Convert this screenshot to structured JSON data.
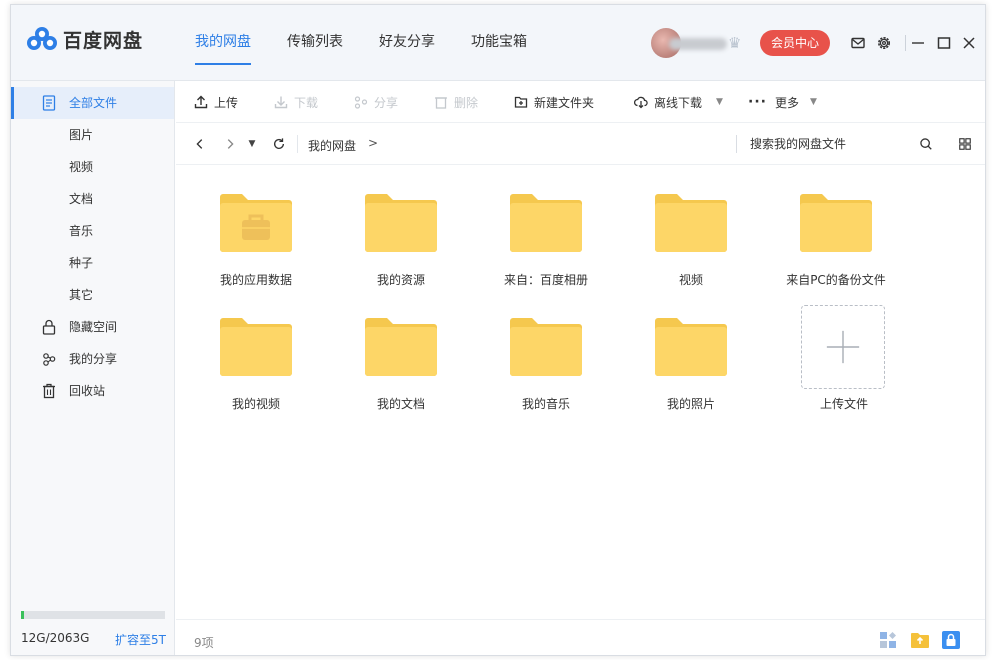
{
  "app": {
    "name": "百度网盘"
  },
  "nav": [
    {
      "label": "我的网盘"
    },
    {
      "label": "传输列表"
    },
    {
      "label": "好友分享"
    },
    {
      "label": "功能宝箱"
    }
  ],
  "header": {
    "vip_label": "会员中心"
  },
  "sidebar": {
    "items": [
      {
        "label": "全部文件",
        "icon": "document-icon"
      },
      {
        "label": "图片"
      },
      {
        "label": "视频"
      },
      {
        "label": "文档"
      },
      {
        "label": "音乐"
      },
      {
        "label": "种子"
      },
      {
        "label": "其它"
      },
      {
        "label": "隐藏空间",
        "icon": "lock-icon"
      },
      {
        "label": "我的分享",
        "icon": "share-icon"
      },
      {
        "label": "回收站",
        "icon": "trash-icon"
      }
    ],
    "storage": {
      "text": "12G/2063G",
      "used_fraction": 0.006,
      "expand_label": "扩容至5T"
    }
  },
  "toolbar": {
    "upload": "上传",
    "download": "下载",
    "share": "分享",
    "delete": "删除",
    "new_folder": "新建文件夹",
    "offline_download": "离线下载",
    "more": "更多"
  },
  "path": {
    "crumb": "我的网盘",
    "arrow": ">",
    "search_placeholder": "搜索我的网盘文件"
  },
  "files": [
    {
      "name": "我的应用数据",
      "type": "app-folder"
    },
    {
      "name": "我的资源",
      "type": "folder"
    },
    {
      "name": "来自：百度相册",
      "type": "folder"
    },
    {
      "name": "视频",
      "type": "folder"
    },
    {
      "name": "来自PC的备份文件",
      "type": "folder"
    },
    {
      "name": "我的视频",
      "type": "folder"
    },
    {
      "name": "我的文档",
      "type": "folder"
    },
    {
      "name": "我的音乐",
      "type": "folder"
    },
    {
      "name": "我的照片",
      "type": "folder"
    }
  ],
  "upload_tile": {
    "label": "上传文件"
  },
  "status": {
    "count": "9项"
  },
  "colors": {
    "accent": "#2e7fe6",
    "folder": "#fdd667",
    "folder_tab": "#f5c84e",
    "vip": "#e8524a",
    "storage": "#3ac05b"
  }
}
